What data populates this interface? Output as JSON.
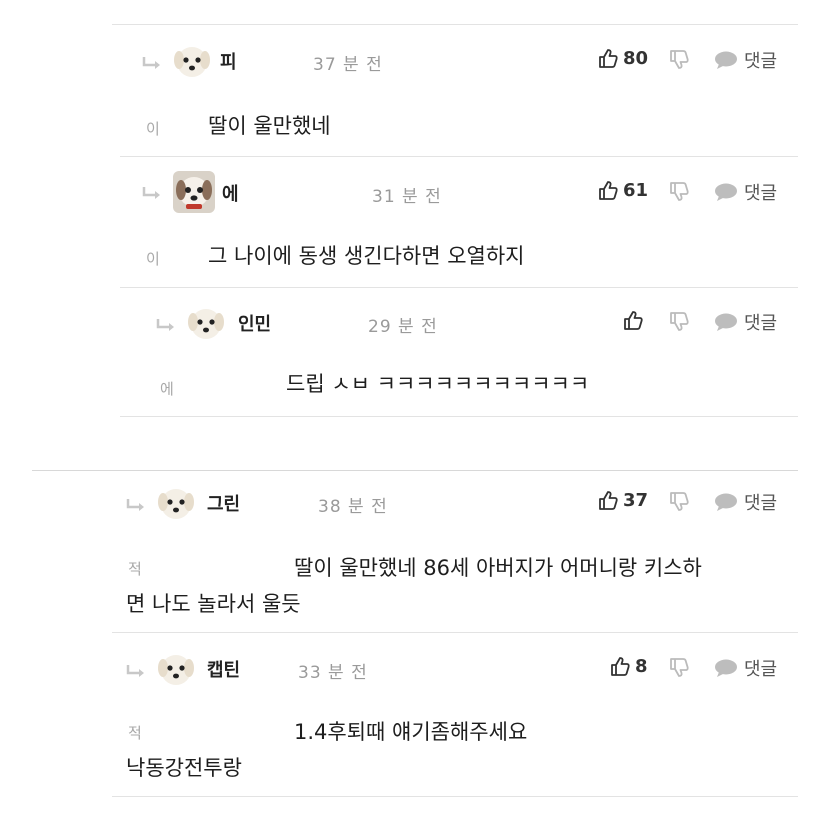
{
  "comments": [
    {
      "name": "피",
      "time": "37 분 전",
      "likes": "80",
      "initial": "이",
      "text": [
        "딸이 울만했네"
      ],
      "reply_label": "댓글"
    },
    {
      "name": "에",
      "time": "31 분 전",
      "likes": "61",
      "initial": "이",
      "text": [
        "그 나이에 동생 생긴다하면 오열하지"
      ],
      "reply_label": "댓글"
    },
    {
      "name": "인민",
      "time": "29 분 전",
      "likes": "",
      "initial": "에",
      "text": [
        "드립 ㅅㅂ ㅋㅋㅋㅋㅋㅋㅋㅋㅋㅋㅋ"
      ],
      "reply_label": "댓글"
    },
    {
      "name": "그린",
      "time": "38 분 전",
      "likes": "37",
      "initial": "적",
      "text": [
        "딸이 울만했네 86세 아버지가 어머니랑 키스하",
        "면 나도 놀라서 울듯"
      ],
      "reply_label": "댓글"
    },
    {
      "name": "캡틴",
      "time": "33 분 전",
      "likes": "8",
      "initial": "적",
      "text": [
        "1.4후퇴때 얘기좀해주세요",
        "낙동강전투랑"
      ],
      "reply_label": "댓글"
    }
  ],
  "icons": {
    "reply_arrow": "reply-arrow-icon",
    "like": "thumbs-up-icon",
    "dislike": "thumbs-down-icon",
    "comment": "speech-bubble-icon",
    "avatar": "dog-avatar-icon"
  }
}
